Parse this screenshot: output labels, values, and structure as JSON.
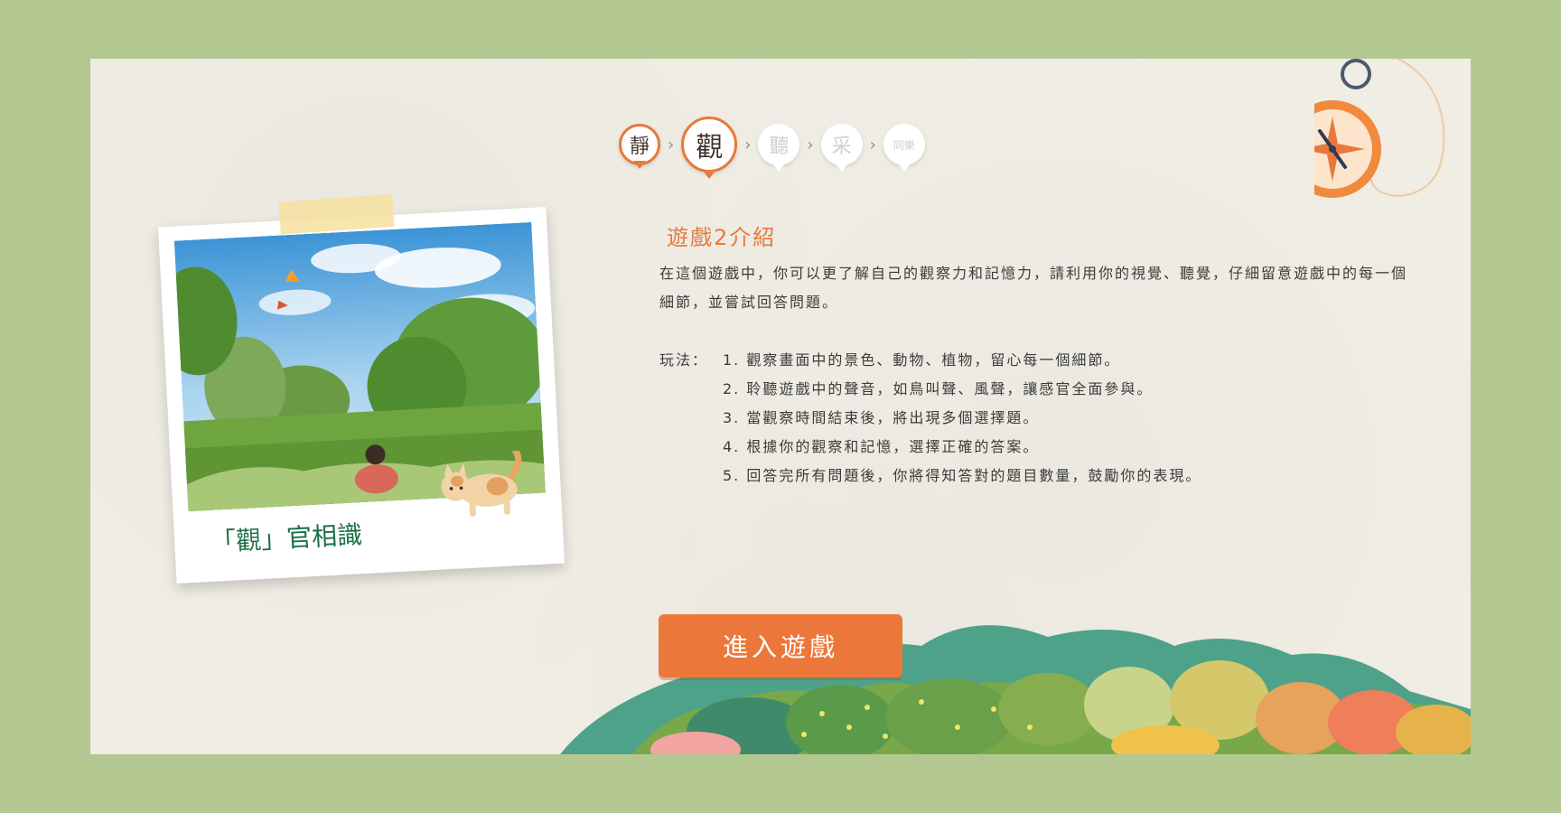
{
  "steps": [
    {
      "label": "靜",
      "state": "done"
    },
    {
      "label": "觀",
      "state": "active"
    },
    {
      "label": "聽",
      "state": "locked"
    },
    {
      "label": "采",
      "state": "locked"
    },
    {
      "label": "同樂",
      "state": "locked"
    }
  ],
  "step_separator": "›",
  "photo": {
    "caption": "「觀」官相識"
  },
  "intro": {
    "title": "遊戲2介紹",
    "description": "在這個遊戲中，你可以更了解自己的觀察力和記憶力，請利用你的視覺、聽覺，仔細留意遊戲中的每一個細節，並嘗試回答問題。",
    "rules_label": "玩法：",
    "rules": [
      "1. 觀察畫面中的景色、動物、植物，留心每一個細節。",
      "2. 聆聽遊戲中的聲音，如鳥叫聲、風聲，讓感官全面參與。",
      "3. 當觀察時間結束後，將出現多個選擇題。",
      "4. 根據你的觀察和記憶，選擇正確的答案。",
      "5. 回答完所有問題後，你將得知答對的題目數量，鼓勵你的表現。"
    ]
  },
  "enter_button": {
    "label": "進入遊戲"
  },
  "colors": {
    "background": "#b3c890",
    "paper": "#efede4",
    "accent": "#e8793c",
    "caption_green": "#1e7048"
  },
  "icons": {
    "compass": "compass-icon",
    "cat": "cat-illustration"
  }
}
